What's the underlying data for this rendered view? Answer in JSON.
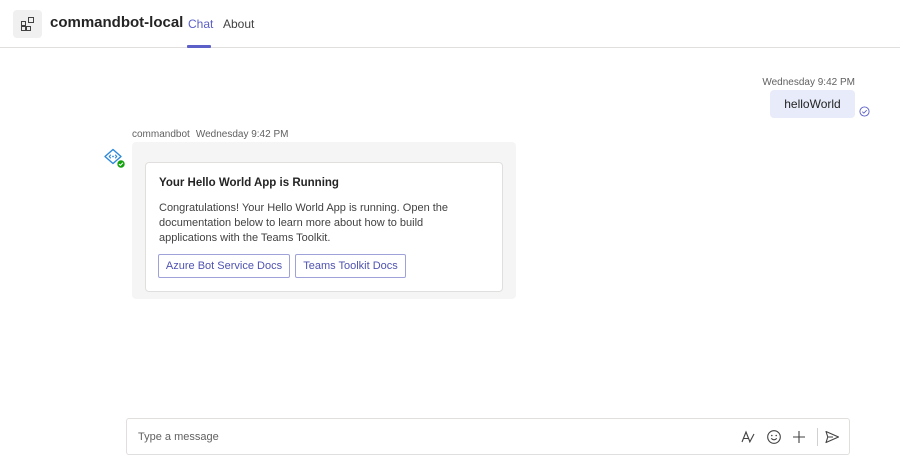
{
  "header": {
    "app_name": "commandbot-local",
    "tabs": [
      {
        "label": "Chat",
        "active": true
      },
      {
        "label": "About",
        "active": false
      }
    ],
    "accent_color": "#5b5fc7"
  },
  "outgoing_message": {
    "timestamp": "Wednesday 9:42 PM",
    "text": "helloWorld",
    "status_icon": "read-receipt-icon"
  },
  "bot_message": {
    "sender": "commandbot",
    "timestamp": "Wednesday 9:42 PM",
    "avatar_icon": "bot-code-icon",
    "card": {
      "title": "Your Hello World App is Running",
      "body": "Congratulations! Your Hello World App is running. Open the documentation below to learn more about how to build applications with the Teams Toolkit.",
      "actions": [
        {
          "label": "Azure Bot Service Docs"
        },
        {
          "label": "Teams Toolkit Docs"
        }
      ]
    }
  },
  "compose": {
    "placeholder": "Type a message",
    "icons": [
      "format-icon",
      "emoji-icon",
      "add-icon",
      "send-icon"
    ]
  }
}
